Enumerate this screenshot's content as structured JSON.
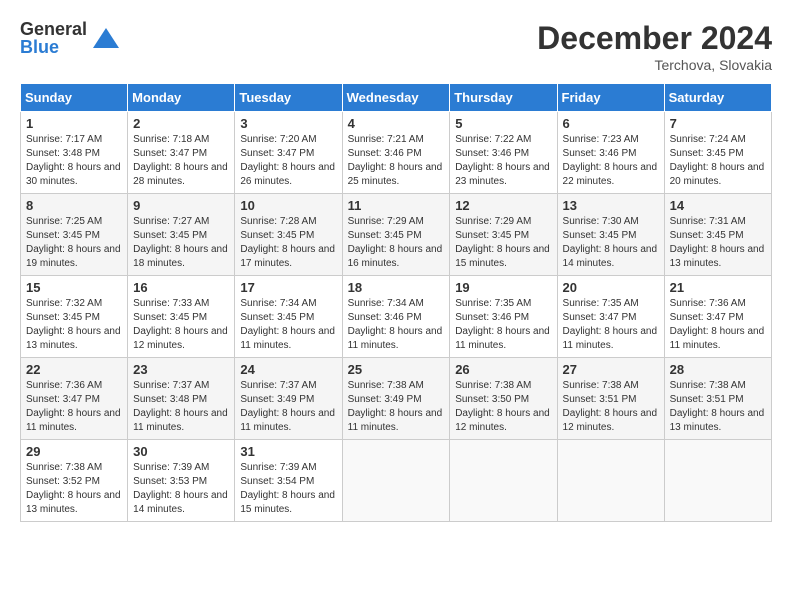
{
  "logo": {
    "general": "General",
    "blue": "Blue"
  },
  "title": "December 2024",
  "subtitle": "Terchova, Slovakia",
  "days_of_week": [
    "Sunday",
    "Monday",
    "Tuesday",
    "Wednesday",
    "Thursday",
    "Friday",
    "Saturday"
  ],
  "weeks": [
    [
      {
        "day": "1",
        "sunrise": "Sunrise: 7:17 AM",
        "sunset": "Sunset: 3:48 PM",
        "daylight": "Daylight: 8 hours and 30 minutes."
      },
      {
        "day": "2",
        "sunrise": "Sunrise: 7:18 AM",
        "sunset": "Sunset: 3:47 PM",
        "daylight": "Daylight: 8 hours and 28 minutes."
      },
      {
        "day": "3",
        "sunrise": "Sunrise: 7:20 AM",
        "sunset": "Sunset: 3:47 PM",
        "daylight": "Daylight: 8 hours and 26 minutes."
      },
      {
        "day": "4",
        "sunrise": "Sunrise: 7:21 AM",
        "sunset": "Sunset: 3:46 PM",
        "daylight": "Daylight: 8 hours and 25 minutes."
      },
      {
        "day": "5",
        "sunrise": "Sunrise: 7:22 AM",
        "sunset": "Sunset: 3:46 PM",
        "daylight": "Daylight: 8 hours and 23 minutes."
      },
      {
        "day": "6",
        "sunrise": "Sunrise: 7:23 AM",
        "sunset": "Sunset: 3:46 PM",
        "daylight": "Daylight: 8 hours and 22 minutes."
      },
      {
        "day": "7",
        "sunrise": "Sunrise: 7:24 AM",
        "sunset": "Sunset: 3:45 PM",
        "daylight": "Daylight: 8 hours and 20 minutes."
      }
    ],
    [
      {
        "day": "8",
        "sunrise": "Sunrise: 7:25 AM",
        "sunset": "Sunset: 3:45 PM",
        "daylight": "Daylight: 8 hours and 19 minutes."
      },
      {
        "day": "9",
        "sunrise": "Sunrise: 7:27 AM",
        "sunset": "Sunset: 3:45 PM",
        "daylight": "Daylight: 8 hours and 18 minutes."
      },
      {
        "day": "10",
        "sunrise": "Sunrise: 7:28 AM",
        "sunset": "Sunset: 3:45 PM",
        "daylight": "Daylight: 8 hours and 17 minutes."
      },
      {
        "day": "11",
        "sunrise": "Sunrise: 7:29 AM",
        "sunset": "Sunset: 3:45 PM",
        "daylight": "Daylight: 8 hours and 16 minutes."
      },
      {
        "day": "12",
        "sunrise": "Sunrise: 7:29 AM",
        "sunset": "Sunset: 3:45 PM",
        "daylight": "Daylight: 8 hours and 15 minutes."
      },
      {
        "day": "13",
        "sunrise": "Sunrise: 7:30 AM",
        "sunset": "Sunset: 3:45 PM",
        "daylight": "Daylight: 8 hours and 14 minutes."
      },
      {
        "day": "14",
        "sunrise": "Sunrise: 7:31 AM",
        "sunset": "Sunset: 3:45 PM",
        "daylight": "Daylight: 8 hours and 13 minutes."
      }
    ],
    [
      {
        "day": "15",
        "sunrise": "Sunrise: 7:32 AM",
        "sunset": "Sunset: 3:45 PM",
        "daylight": "Daylight: 8 hours and 13 minutes."
      },
      {
        "day": "16",
        "sunrise": "Sunrise: 7:33 AM",
        "sunset": "Sunset: 3:45 PM",
        "daylight": "Daylight: 8 hours and 12 minutes."
      },
      {
        "day": "17",
        "sunrise": "Sunrise: 7:34 AM",
        "sunset": "Sunset: 3:45 PM",
        "daylight": "Daylight: 8 hours and 11 minutes."
      },
      {
        "day": "18",
        "sunrise": "Sunrise: 7:34 AM",
        "sunset": "Sunset: 3:46 PM",
        "daylight": "Daylight: 8 hours and 11 minutes."
      },
      {
        "day": "19",
        "sunrise": "Sunrise: 7:35 AM",
        "sunset": "Sunset: 3:46 PM",
        "daylight": "Daylight: 8 hours and 11 minutes."
      },
      {
        "day": "20",
        "sunrise": "Sunrise: 7:35 AM",
        "sunset": "Sunset: 3:47 PM",
        "daylight": "Daylight: 8 hours and 11 minutes."
      },
      {
        "day": "21",
        "sunrise": "Sunrise: 7:36 AM",
        "sunset": "Sunset: 3:47 PM",
        "daylight": "Daylight: 8 hours and 11 minutes."
      }
    ],
    [
      {
        "day": "22",
        "sunrise": "Sunrise: 7:36 AM",
        "sunset": "Sunset: 3:47 PM",
        "daylight": "Daylight: 8 hours and 11 minutes."
      },
      {
        "day": "23",
        "sunrise": "Sunrise: 7:37 AM",
        "sunset": "Sunset: 3:48 PM",
        "daylight": "Daylight: 8 hours and 11 minutes."
      },
      {
        "day": "24",
        "sunrise": "Sunrise: 7:37 AM",
        "sunset": "Sunset: 3:49 PM",
        "daylight": "Daylight: 8 hours and 11 minutes."
      },
      {
        "day": "25",
        "sunrise": "Sunrise: 7:38 AM",
        "sunset": "Sunset: 3:49 PM",
        "daylight": "Daylight: 8 hours and 11 minutes."
      },
      {
        "day": "26",
        "sunrise": "Sunrise: 7:38 AM",
        "sunset": "Sunset: 3:50 PM",
        "daylight": "Daylight: 8 hours and 12 minutes."
      },
      {
        "day": "27",
        "sunrise": "Sunrise: 7:38 AM",
        "sunset": "Sunset: 3:51 PM",
        "daylight": "Daylight: 8 hours and 12 minutes."
      },
      {
        "day": "28",
        "sunrise": "Sunrise: 7:38 AM",
        "sunset": "Sunset: 3:51 PM",
        "daylight": "Daylight: 8 hours and 13 minutes."
      }
    ],
    [
      {
        "day": "29",
        "sunrise": "Sunrise: 7:38 AM",
        "sunset": "Sunset: 3:52 PM",
        "daylight": "Daylight: 8 hours and 13 minutes."
      },
      {
        "day": "30",
        "sunrise": "Sunrise: 7:39 AM",
        "sunset": "Sunset: 3:53 PM",
        "daylight": "Daylight: 8 hours and 14 minutes."
      },
      {
        "day": "31",
        "sunrise": "Sunrise: 7:39 AM",
        "sunset": "Sunset: 3:54 PM",
        "daylight": "Daylight: 8 hours and 15 minutes."
      },
      null,
      null,
      null,
      null
    ]
  ]
}
